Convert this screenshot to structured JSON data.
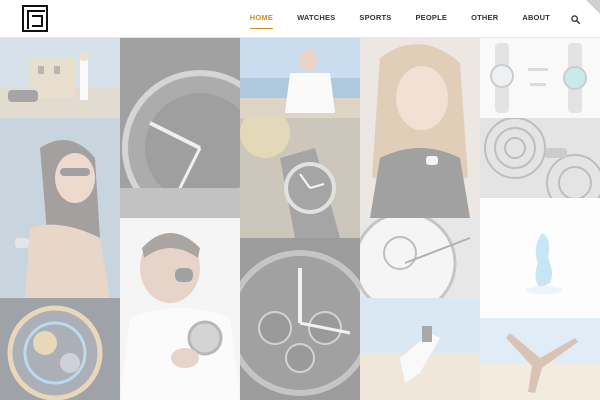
{
  "header": {
    "logo_icon": "monogram-p-logo",
    "nav": [
      {
        "label": "HOME",
        "active": true
      },
      {
        "label": "WATCHES",
        "active": false
      },
      {
        "label": "SPORTS",
        "active": false
      },
      {
        "label": "PEOPLE",
        "active": false
      },
      {
        "label": "OTHER",
        "active": false
      },
      {
        "label": "ABOUT",
        "active": false
      }
    ],
    "search_icon": "search-icon"
  },
  "colors": {
    "accent": "#c8912e",
    "nav_text": "#333333",
    "background": "#ffffff"
  }
}
